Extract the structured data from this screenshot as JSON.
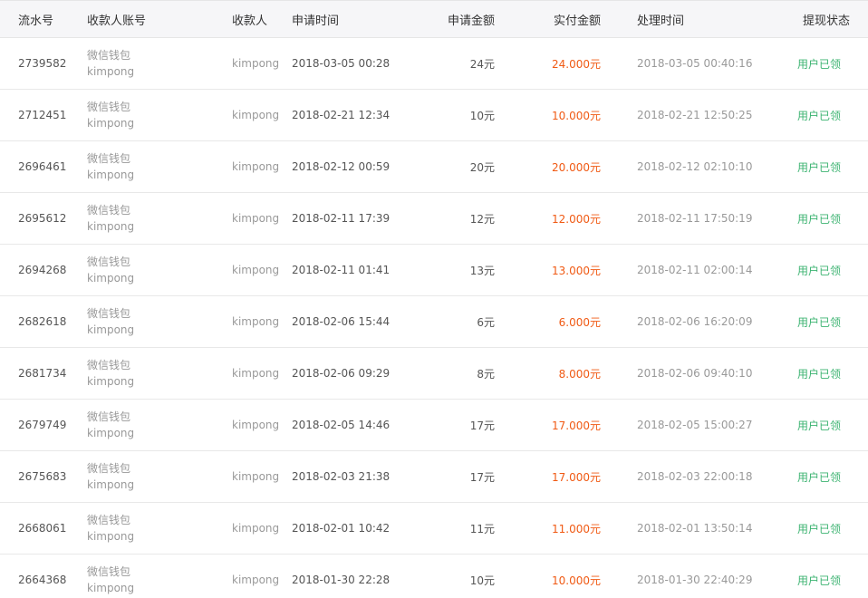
{
  "table": {
    "headers": {
      "serial": "流水号",
      "account": "收款人账号",
      "payee": "收款人",
      "apply_time": "申请时间",
      "apply_amount": "申请金额",
      "paid_amount": "实付金额",
      "process_time": "处理时间",
      "status": "提现状态"
    },
    "rows": [
      {
        "serial": "2739582",
        "account_type": "微信钱包",
        "account_name": "kimpong",
        "payee": "kimpong",
        "apply_time": "2018-03-05 00:28",
        "apply_amount": "24元",
        "paid_amount": "24.000元",
        "process_time": "2018-03-05 00:40:16",
        "status": "用户已领"
      },
      {
        "serial": "2712451",
        "account_type": "微信钱包",
        "account_name": "kimpong",
        "payee": "kimpong",
        "apply_time": "2018-02-21 12:34",
        "apply_amount": "10元",
        "paid_amount": "10.000元",
        "process_time": "2018-02-21 12:50:25",
        "status": "用户已领"
      },
      {
        "serial": "2696461",
        "account_type": "微信钱包",
        "account_name": "kimpong",
        "payee": "kimpong",
        "apply_time": "2018-02-12 00:59",
        "apply_amount": "20元",
        "paid_amount": "20.000元",
        "process_time": "2018-02-12 02:10:10",
        "status": "用户已领"
      },
      {
        "serial": "2695612",
        "account_type": "微信钱包",
        "account_name": "kimpong",
        "payee": "kimpong",
        "apply_time": "2018-02-11 17:39",
        "apply_amount": "12元",
        "paid_amount": "12.000元",
        "process_time": "2018-02-11 17:50:19",
        "status": "用户已领"
      },
      {
        "serial": "2694268",
        "account_type": "微信钱包",
        "account_name": "kimpong",
        "payee": "kimpong",
        "apply_time": "2018-02-11 01:41",
        "apply_amount": "13元",
        "paid_amount": "13.000元",
        "process_time": "2018-02-11 02:00:14",
        "status": "用户已领"
      },
      {
        "serial": "2682618",
        "account_type": "微信钱包",
        "account_name": "kimpong",
        "payee": "kimpong",
        "apply_time": "2018-02-06 15:44",
        "apply_amount": "6元",
        "paid_amount": "6.000元",
        "process_time": "2018-02-06 16:20:09",
        "status": "用户已领"
      },
      {
        "serial": "2681734",
        "account_type": "微信钱包",
        "account_name": "kimpong",
        "payee": "kimpong",
        "apply_time": "2018-02-06 09:29",
        "apply_amount": "8元",
        "paid_amount": "8.000元",
        "process_time": "2018-02-06 09:40:10",
        "status": "用户已领"
      },
      {
        "serial": "2679749",
        "account_type": "微信钱包",
        "account_name": "kimpong",
        "payee": "kimpong",
        "apply_time": "2018-02-05 14:46",
        "apply_amount": "17元",
        "paid_amount": "17.000元",
        "process_time": "2018-02-05 15:00:27",
        "status": "用户已领"
      },
      {
        "serial": "2675683",
        "account_type": "微信钱包",
        "account_name": "kimpong",
        "payee": "kimpong",
        "apply_time": "2018-02-03 21:38",
        "apply_amount": "17元",
        "paid_amount": "17.000元",
        "process_time": "2018-02-03 22:00:18",
        "status": "用户已领"
      },
      {
        "serial": "2668061",
        "account_type": "微信钱包",
        "account_name": "kimpong",
        "payee": "kimpong",
        "apply_time": "2018-02-01 10:42",
        "apply_amount": "11元",
        "paid_amount": "11.000元",
        "process_time": "2018-02-01 13:50:14",
        "status": "用户已领"
      },
      {
        "serial": "2664368",
        "account_type": "微信钱包",
        "account_name": "kimpong",
        "payee": "kimpong",
        "apply_time": "2018-01-30 22:28",
        "apply_amount": "10元",
        "paid_amount": "10.000元",
        "process_time": "2018-01-30 22:40:29",
        "status": "用户已领"
      }
    ]
  },
  "colors": {
    "paid_amount": "#f05a14",
    "status": "#3cb371",
    "header_bg": "#f6f6f8"
  }
}
